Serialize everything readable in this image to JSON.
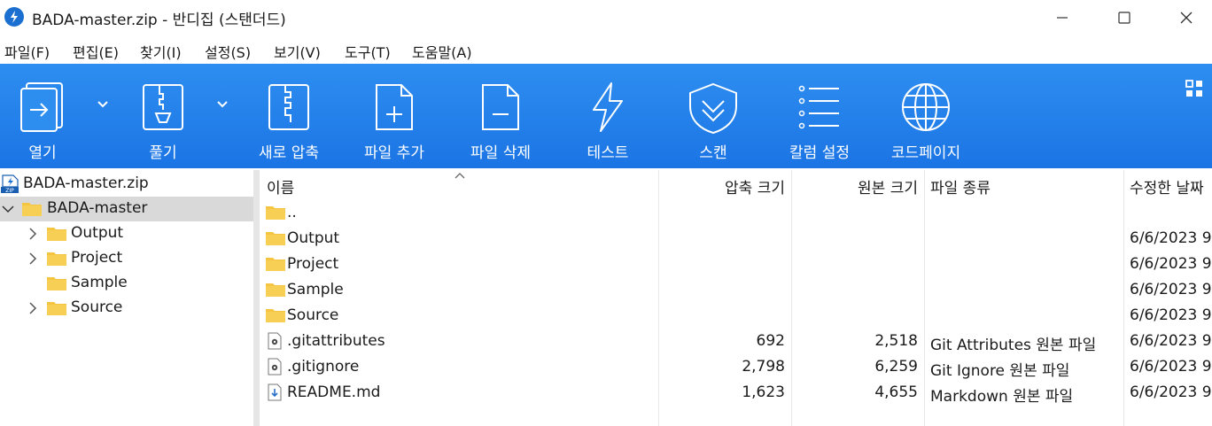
{
  "window": {
    "title": "BADA-master.zip - 반디집 (스탠더드)",
    "controls": {
      "minimize": "minimize",
      "maximize": "maximize",
      "close": "close"
    }
  },
  "menu": [
    {
      "label": "파일(F)"
    },
    {
      "label": "편집(E)"
    },
    {
      "label": "찾기(I)"
    },
    {
      "label": "설정(S)"
    },
    {
      "label": "보기(V)"
    },
    {
      "label": "도구(T)"
    },
    {
      "label": "도움말(A)"
    }
  ],
  "toolbar": {
    "open": "열기",
    "extract": "풀기",
    "new_archive": "새로 압축",
    "add_file": "파일 추가",
    "delete_file": "파일 삭제",
    "test": "테스트",
    "scan": "스캔",
    "column_settings": "칼럼 설정",
    "codepage": "코드페이지"
  },
  "tree": {
    "root": "BADA-master.zip",
    "items": [
      {
        "label": "BADA-master",
        "expanded": true,
        "selected": true
      },
      {
        "label": "Output",
        "expandable": true
      },
      {
        "label": "Project",
        "expandable": true
      },
      {
        "label": "Sample",
        "expandable": false
      },
      {
        "label": "Source",
        "expandable": true
      }
    ]
  },
  "columns": {
    "name": "이름",
    "packed": "압축 크기",
    "original": "원본 크기",
    "type": "파일 종류",
    "modified": "수정한 날짜"
  },
  "files": [
    {
      "icon": "folder-icon",
      "name": "..",
      "packed": "",
      "original": "",
      "type": "",
      "modified": ""
    },
    {
      "icon": "folder-icon",
      "name": "Output",
      "packed": "",
      "original": "",
      "type": "",
      "modified": "6/6/2023 9:"
    },
    {
      "icon": "folder-icon",
      "name": "Project",
      "packed": "",
      "original": "",
      "type": "",
      "modified": "6/6/2023 9:"
    },
    {
      "icon": "folder-icon",
      "name": "Sample",
      "packed": "",
      "original": "",
      "type": "",
      "modified": "6/6/2023 9:"
    },
    {
      "icon": "folder-icon",
      "name": "Source",
      "packed": "",
      "original": "",
      "type": "",
      "modified": "6/6/2023 9:"
    },
    {
      "icon": "settings-file-icon",
      "name": ".gitattributes",
      "packed": "692",
      "original": "2,518",
      "type": "Git Attributes 원본 파일",
      "modified": "6/6/2023 9:"
    },
    {
      "icon": "settings-file-icon",
      "name": ".gitignore",
      "packed": "2,798",
      "original": "6,259",
      "type": "Git Ignore 원본 파일",
      "modified": "6/6/2023 9:"
    },
    {
      "icon": "markdown-file-icon",
      "name": "README.md",
      "packed": "1,623",
      "original": "4,655",
      "type": "Markdown 원본 파일",
      "modified": "6/6/2023 9:"
    }
  ],
  "colors": {
    "toolbar": "#1b74e4",
    "folder": "#f5c542",
    "selection": "#d9d9d9"
  }
}
